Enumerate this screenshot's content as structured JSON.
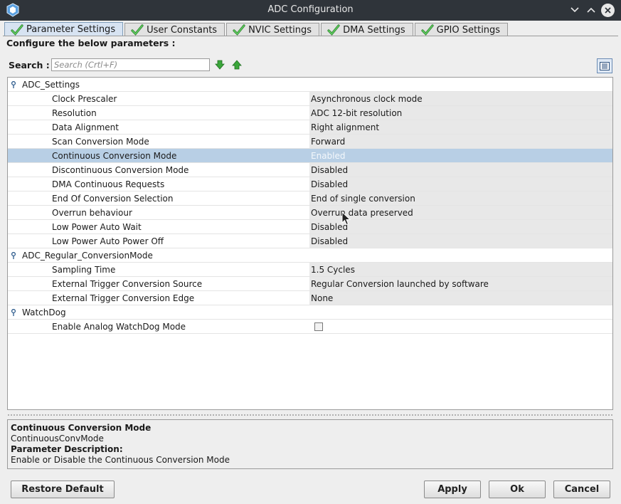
{
  "window": {
    "title": "ADC Configuration"
  },
  "tabs": [
    {
      "label": "Parameter Settings",
      "active": true
    },
    {
      "label": "User Constants",
      "active": false
    },
    {
      "label": "NVIC Settings",
      "active": false
    },
    {
      "label": "DMA Settings",
      "active": false
    },
    {
      "label": "GPIO Settings",
      "active": false
    }
  ],
  "section_label": "Configure the below parameters :",
  "search": {
    "label": "Search :",
    "placeholder": "Search (Crtl+F)"
  },
  "groups": [
    {
      "name": "ADC_Settings",
      "params": [
        {
          "name": "Clock Prescaler",
          "value": "Asynchronous clock mode"
        },
        {
          "name": "Resolution",
          "value": "ADC 12-bit resolution"
        },
        {
          "name": "Data Alignment",
          "value": "Right alignment"
        },
        {
          "name": "Scan Conversion Mode",
          "value": "Forward"
        },
        {
          "name": "Continuous Conversion Mode",
          "value": "Enabled",
          "selected": true
        },
        {
          "name": "Discontinuous Conversion Mode",
          "value": "Disabled"
        },
        {
          "name": "DMA Continuous Requests",
          "value": "Disabled"
        },
        {
          "name": "End Of Conversion Selection",
          "value": "End of single conversion"
        },
        {
          "name": "Overrun behaviour",
          "value": "Overrun data preserved"
        },
        {
          "name": "Low Power Auto Wait",
          "value": "Disabled"
        },
        {
          "name": "Low Power Auto Power Off",
          "value": "Disabled"
        }
      ]
    },
    {
      "name": "ADC_Regular_ConversionMode",
      "params": [
        {
          "name": "Sampling Time",
          "value": "1.5 Cycles"
        },
        {
          "name": "External Trigger Conversion Source",
          "value": "Regular Conversion launched by software"
        },
        {
          "name": "External Trigger Conversion Edge",
          "value": "None"
        }
      ]
    },
    {
      "name": "WatchDog",
      "params": [
        {
          "name": "Enable Analog WatchDog Mode",
          "checkbox": true,
          "checked": false
        }
      ]
    }
  ],
  "description": {
    "title": "Continuous Conversion Mode",
    "id": "ContinuousConvMode",
    "heading": "Parameter Description:",
    "text": "Enable or Disable the Continuous Conversion Mode"
  },
  "buttons": {
    "restore": "Restore Default",
    "apply": "Apply",
    "ok": "Ok",
    "cancel": "Cancel"
  },
  "colors": {
    "selection": "#b8cfe5",
    "titlebar": "#2f343a",
    "check_green": "#3aa63a"
  }
}
